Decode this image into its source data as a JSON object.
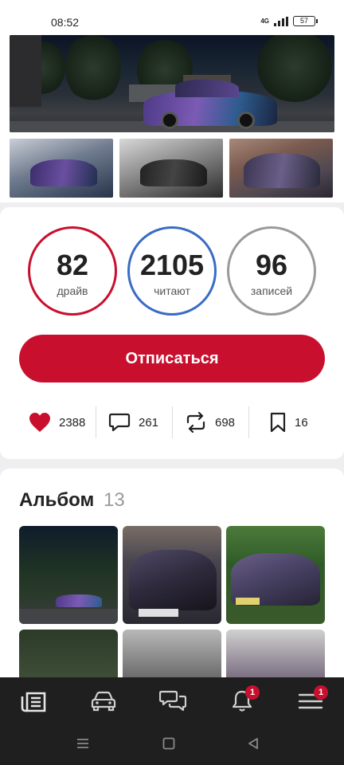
{
  "status_bar": {
    "time": "08:52",
    "network": "4G",
    "battery": "57"
  },
  "stats": {
    "drive": {
      "value": "82",
      "label": "драйв",
      "color": "#c8102e"
    },
    "followers": {
      "value": "2105",
      "label": "читают",
      "color": "#3a6bc4"
    },
    "posts": {
      "value": "96",
      "label": "записей",
      "color": "#9a9a9a"
    }
  },
  "unfollow_button": {
    "label": "Отписаться",
    "color": "#c8102e"
  },
  "actions": {
    "likes": "2388",
    "comments": "261",
    "reposts": "698",
    "bookmarks": "16"
  },
  "album": {
    "title": "Альбом",
    "count": "13"
  },
  "bottom_nav": {
    "icons": [
      "feed-icon",
      "garage-car-icon",
      "messages-icon",
      "notifications-bell-icon",
      "menu-icon"
    ],
    "notifications_badge": "1",
    "menu_badge": "1",
    "badge_color": "#c8102e"
  },
  "system_nav": {
    "icons": [
      "recent-apps-icon",
      "home-icon",
      "back-icon"
    ]
  }
}
